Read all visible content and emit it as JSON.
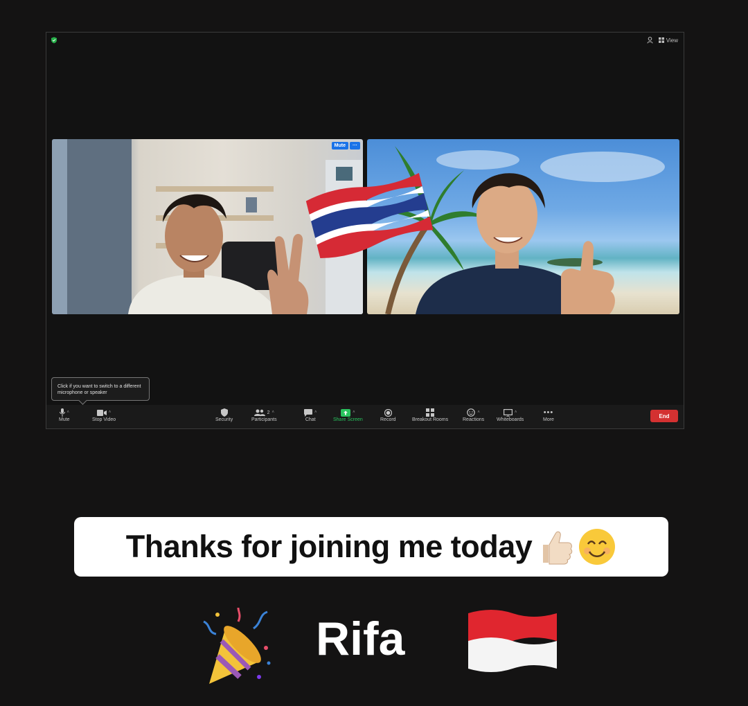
{
  "meeting": {
    "top_right": {
      "view_label": "View"
    },
    "tooltip": "Click if you want to switch to a different microphone or speaker",
    "tile_left": {
      "unmute_label": "Mute",
      "more_label": "···"
    },
    "toolbar": {
      "mute": "Mute",
      "stop_video": "Stop Video",
      "security": "Security",
      "participants": "Participants",
      "participants_count": "2",
      "chat": "Chat",
      "share_screen": "Share Screen",
      "record": "Record",
      "breakout_rooms": "Breakout Rooms",
      "reactions": "Reactions",
      "whiteboards": "Whiteboards",
      "more": "More",
      "end": "End"
    },
    "colors": {
      "end": "#d43131",
      "share": "#29c45e",
      "unmute": "#1a73e8"
    }
  },
  "caption": {
    "text": "Thanks for joining me today"
  },
  "name": {
    "text": "Rifa"
  }
}
